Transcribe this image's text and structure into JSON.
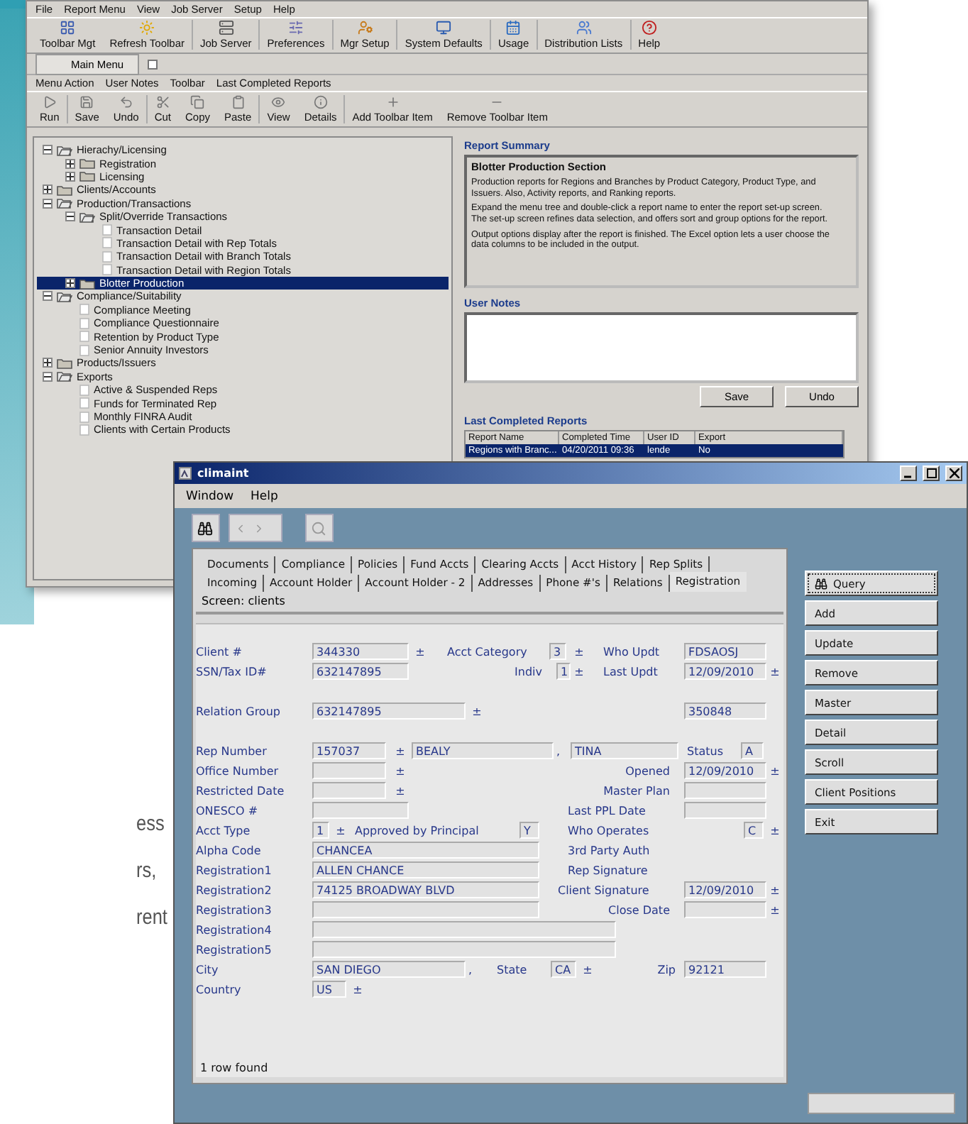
{
  "page_text_fragments": [
    "ess",
    "rs,",
    "rent"
  ],
  "report_window": {
    "menu": [
      "File",
      "Report Menu",
      "View",
      "Job Server",
      "Setup",
      "Help"
    ],
    "toolbar": [
      "Toolbar Mgt",
      "Refresh Toolbar",
      "Job Server",
      "Preferences",
      "Mgr Setup",
      "System Defaults",
      "Usage",
      "Distribution Lists",
      "Help"
    ],
    "tab": {
      "label": "Main Menu",
      "selected": true
    },
    "submenu": [
      "Menu Action",
      "User Notes",
      "Toolbar",
      "Last Completed Reports"
    ],
    "actions": [
      "Run",
      "Save",
      "Undo",
      "Cut",
      "Copy",
      "Paste",
      "View",
      "Details",
      "Add Toolbar Item",
      "Remove Toolbar Item"
    ],
    "tree": [
      {
        "label": "Hierachy/Licensing",
        "kind": "folder",
        "expanded": true,
        "selected": false,
        "children": [
          {
            "label": "Registration",
            "kind": "folder",
            "expanded": false,
            "selected": false
          },
          {
            "label": "Licensing",
            "kind": "folder",
            "expanded": false,
            "selected": false
          }
        ]
      },
      {
        "label": "Clients/Accounts",
        "kind": "folder",
        "expanded": false,
        "selected": false
      },
      {
        "label": "Production/Transactions",
        "kind": "folder",
        "expanded": true,
        "selected": false,
        "children": [
          {
            "label": "Split/Override Transactions",
            "kind": "folder",
            "expanded": true,
            "selected": false,
            "children": [
              {
                "label": "Transaction Detail",
                "kind": "report",
                "selected": false
              },
              {
                "label": "Transaction Detail with Rep Totals",
                "kind": "report",
                "selected": false
              },
              {
                "label": "Transaction Detail with Branch Totals",
                "kind": "report",
                "selected": false
              },
              {
                "label": "Transaction Detail with Region Totals",
                "kind": "report",
                "selected": false
              }
            ]
          },
          {
            "label": "Blotter Production",
            "kind": "folder",
            "expanded": false,
            "selected": true
          }
        ]
      },
      {
        "label": "Compliance/Suitability",
        "kind": "folder",
        "expanded": true,
        "selected": false,
        "children": [
          {
            "label": "Compliance Meeting",
            "kind": "report",
            "selected": false
          },
          {
            "label": "Compliance Questionnaire",
            "kind": "report",
            "selected": false
          },
          {
            "label": "Retention by Product Type",
            "kind": "report",
            "selected": false
          },
          {
            "label": "Senior Annuity Investors",
            "kind": "report",
            "selected": false
          }
        ]
      },
      {
        "label": "Products/Issuers",
        "kind": "folder",
        "expanded": false,
        "selected": false
      },
      {
        "label": "Exports",
        "kind": "folder",
        "expanded": true,
        "selected": false,
        "children": [
          {
            "label": "Active & Suspended Reps",
            "kind": "report",
            "selected": false
          },
          {
            "label": "Funds for Terminated Rep",
            "kind": "report",
            "selected": false
          },
          {
            "label": "Monthly FINRA Audit",
            "kind": "report",
            "selected": false
          },
          {
            "label": "Clients with Certain Products",
            "kind": "report",
            "selected": false
          }
        ]
      }
    ],
    "summary": {
      "heading": "Report Summary",
      "title": "Blotter Production Section",
      "paragraphs": [
        "Production reports for Regions and Branches by Product Category, Product Type, and Issuers. Also, Activity reports, and Ranking reports.",
        "Expand the menu tree and double-click a report name to enter the report set-up screen. The set-up screen refines data selection, and offers sort and group options for the report.",
        "Output options display after the report is finished. The Excel option lets a user choose the data columns to be included in the output."
      ]
    },
    "notes": {
      "heading": "User Notes",
      "buttons": [
        "Save",
        "Undo"
      ]
    },
    "last_reports": {
      "heading": "Last Completed Reports",
      "columns": [
        "Report Name",
        "Completed Time",
        "User ID",
        "Export"
      ],
      "rows": [
        {
          "cells": [
            "Regions with Branc...",
            "04/20/2011 09:36",
            "lende",
            "No"
          ],
          "selected": true
        }
      ]
    }
  },
  "client_window": {
    "title": "climaint",
    "menu": [
      "Window",
      "Help"
    ],
    "tab_rows": [
      [
        {
          "label": "Documents",
          "selected": false
        },
        {
          "label": "Compliance",
          "selected": false
        },
        {
          "label": "Policies",
          "selected": false
        },
        {
          "label": "Fund Accts",
          "selected": false
        },
        {
          "label": "Clearing Accts",
          "selected": false
        },
        {
          "label": "Acct History",
          "selected": false
        },
        {
          "label": "Rep Splits",
          "selected": false
        }
      ],
      [
        {
          "label": "Incoming",
          "selected": false
        },
        {
          "label": "Account Holder",
          "selected": false
        },
        {
          "label": "Account Holder - 2",
          "selected": false
        },
        {
          "label": "Addresses",
          "selected": false
        },
        {
          "label": "Phone #'s",
          "selected": false
        },
        {
          "label": "Relations",
          "selected": false
        },
        {
          "label": "Registration",
          "selected": true
        }
      ]
    ],
    "screen": "Screen: clients",
    "form_rows": [
      [
        {
          "kind": "label",
          "text": "Client #"
        },
        {
          "kind": "field",
          "text": "344330"
        },
        {
          "kind": "mark",
          "text": "±"
        },
        {
          "kind": "label",
          "text": "Acct Category"
        },
        {
          "kind": "field",
          "text": "3"
        },
        {
          "kind": "mark",
          "text": "±"
        },
        {
          "kind": "label",
          "text": "Who Updt"
        },
        {
          "kind": "field",
          "text": "FDSAOSJ"
        }
      ],
      [
        {
          "kind": "label",
          "text": "SSN/Tax ID#"
        },
        {
          "kind": "field",
          "text": "632147895"
        },
        {
          "kind": "label",
          "text": "Indiv"
        },
        {
          "kind": "field",
          "text": "1"
        },
        {
          "kind": "mark",
          "text": "±"
        },
        {
          "kind": "label",
          "text": "Last Updt"
        },
        {
          "kind": "field",
          "text": "12/09/2010"
        },
        {
          "kind": "mark",
          "text": "±"
        }
      ],
      [
        {
          "kind": "label",
          "text": "Relation Group"
        },
        {
          "kind": "field",
          "text": "632147895"
        },
        {
          "kind": "mark",
          "text": "±"
        },
        {
          "kind": "field",
          "text": "350848"
        }
      ],
      [
        {
          "kind": "label",
          "text": "Rep Number"
        },
        {
          "kind": "field",
          "text": "157037"
        },
        {
          "kind": "mark",
          "text": "±"
        },
        {
          "kind": "field",
          "text": "BEALY"
        },
        {
          "kind": "label",
          "text": ","
        },
        {
          "kind": "field",
          "text": "TINA"
        },
        {
          "kind": "label",
          "text": "Status"
        },
        {
          "kind": "field",
          "text": "A"
        }
      ],
      [
        {
          "kind": "label",
          "text": "Office Number"
        },
        {
          "kind": "field",
          "text": ""
        },
        {
          "kind": "mark",
          "text": "±"
        },
        {
          "kind": "label",
          "text": "Opened"
        },
        {
          "kind": "field",
          "text": "12/09/2010"
        },
        {
          "kind": "mark",
          "text": "±"
        }
      ],
      [
        {
          "kind": "label",
          "text": "Restricted Date"
        },
        {
          "kind": "field",
          "text": ""
        },
        {
          "kind": "mark",
          "text": "±"
        },
        {
          "kind": "label",
          "text": "Master Plan"
        },
        {
          "kind": "field",
          "text": ""
        }
      ],
      [
        {
          "kind": "label",
          "text": "ONESCO #"
        },
        {
          "kind": "field",
          "text": ""
        },
        {
          "kind": "label",
          "text": "Last PPL Date"
        },
        {
          "kind": "field",
          "text": ""
        }
      ],
      [
        {
          "kind": "label",
          "text": "Acct Type"
        },
        {
          "kind": "field",
          "text": "1"
        },
        {
          "kind": "mark",
          "text": "±"
        },
        {
          "kind": "label",
          "text": "Approved by Principal"
        },
        {
          "kind": "field",
          "text": "Y"
        },
        {
          "kind": "label",
          "text": "Who Operates"
        },
        {
          "kind": "field",
          "text": "C"
        },
        {
          "kind": "mark",
          "text": "±"
        }
      ],
      [
        {
          "kind": "label",
          "text": "Alpha Code"
        },
        {
          "kind": "field",
          "text": "CHANCEA"
        },
        {
          "kind": "label",
          "text": "3rd Party Auth"
        }
      ],
      [
        {
          "kind": "label",
          "text": "Registration1"
        },
        {
          "kind": "field",
          "text": "ALLEN  CHANCE"
        },
        {
          "kind": "label",
          "text": "Rep Signature"
        }
      ],
      [
        {
          "kind": "label",
          "text": "Registration2"
        },
        {
          "kind": "field",
          "text": "74125 BROADWAY BLVD"
        },
        {
          "kind": "label",
          "text": "Client Signature"
        },
        {
          "kind": "field",
          "text": "12/09/2010"
        },
        {
          "kind": "mark",
          "text": "±"
        }
      ],
      [
        {
          "kind": "label",
          "text": "Registration3"
        },
        {
          "kind": "field",
          "text": ""
        },
        {
          "kind": "label",
          "text": "Close Date"
        },
        {
          "kind": "field",
          "text": ""
        },
        {
          "kind": "mark",
          "text": "±"
        }
      ],
      [
        {
          "kind": "label",
          "text": "Registration4"
        },
        {
          "kind": "field",
          "text": ""
        }
      ],
      [
        {
          "kind": "label",
          "text": "Registration5"
        },
        {
          "kind": "field",
          "text": ""
        }
      ],
      [
        {
          "kind": "label",
          "text": "City"
        },
        {
          "kind": "field",
          "text": "SAN DIEGO"
        },
        {
          "kind": "label",
          "text": ","
        },
        {
          "kind": "label",
          "text": "State"
        },
        {
          "kind": "field",
          "text": "CA"
        },
        {
          "kind": "mark",
          "text": "±"
        },
        {
          "kind": "label",
          "text": "Zip"
        },
        {
          "kind": "field",
          "text": "92121"
        }
      ],
      [
        {
          "kind": "label",
          "text": "Country"
        },
        {
          "kind": "field",
          "text": "US"
        },
        {
          "kind": "mark",
          "text": "±"
        }
      ]
    ],
    "status": "1 row found",
    "buttons": [
      "Query",
      "Add",
      "Update",
      "Remove",
      "Master",
      "Detail",
      "Scroll",
      "Client Positions",
      "Exit"
    ]
  }
}
